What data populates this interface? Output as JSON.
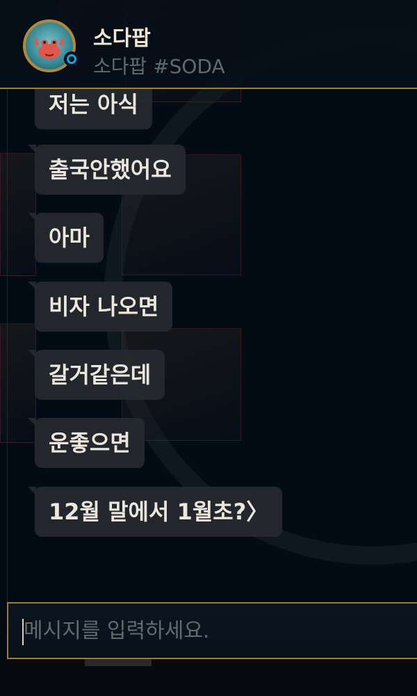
{
  "contact": {
    "name": "소다팝",
    "tag": "소다팝 #SODA",
    "status_color": "#1ea3d6",
    "avatar_icon": "crab-profile-icon"
  },
  "messages": [
    {
      "text": "저는 아식"
    },
    {
      "text": "출국안했어요"
    },
    {
      "text": "아마"
    },
    {
      "text": "비자 나오면"
    },
    {
      "text": "갈거같은데"
    },
    {
      "text": "운좋으면"
    },
    {
      "text": "12월 말에서 1월초?〉"
    }
  ],
  "composer": {
    "placeholder": "메시지를 입력하세요."
  },
  "colors": {
    "accent_gold": "#a3802f",
    "bubble_bg": "#262a30",
    "text": "#ece7dc"
  }
}
